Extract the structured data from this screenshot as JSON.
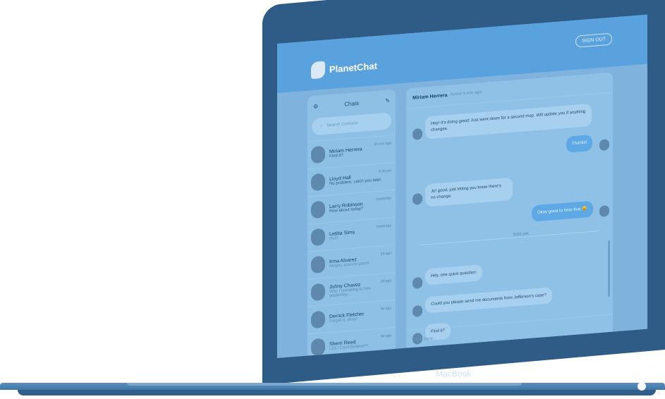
{
  "app": {
    "name": "PlanetChat",
    "signout_label": "SIGN OUT"
  },
  "hardware": {
    "brand": "MacBook"
  },
  "chats": {
    "title": "Chats",
    "search_placeholder": "Search Contacts",
    "items": [
      {
        "name": "Miriam Herrera",
        "message": "Find it?",
        "time": "20 min ago"
      },
      {
        "name": "Lloyd Hall",
        "message": "No problem, catch you later.",
        "time": "6:30 pm"
      },
      {
        "name": "Larry Robinson",
        "message": "How about today?",
        "time": "Yesterday"
      },
      {
        "name": "Letitia Sims",
        "message": "Huh!",
        "time": "Yesterday"
      },
      {
        "name": "Irma Alvarez",
        "message": "Alright, sounds good!",
        "time": "2d ago"
      },
      {
        "name": "Johny Chavez",
        "message": "Was I speaking to him yesterday...",
        "time": "2d ago"
      },
      {
        "name": "Derrick Fletcher",
        "message": "Forget it, okay!",
        "time": "3d ago"
      },
      {
        "name": "Sherri Reed",
        "message": "LOL! Can't Believe!!!",
        "time": "5d ago"
      }
    ]
  },
  "conversation": {
    "contact_name": "Miriam Herrera",
    "contact_status": "Active 5 min ago",
    "messages": [
      {
        "text": "Hey! It's doing great! Just went down for a second map. Will update you if anything changes.",
        "direction": "in"
      },
      {
        "text": "Thanks!",
        "direction": "out"
      },
      {
        "text": "Jo! good, just letting you know there's no change.",
        "direction": "in"
      },
      {
        "text": "Okay great to hear that 😄",
        "direction": "out"
      },
      {
        "text": "Hey, one quick question:",
        "direction": "in"
      },
      {
        "text": "Could you please send me documents from Jefferson's case?",
        "direction": "in"
      },
      {
        "text": "Find it?",
        "direction": "in"
      }
    ],
    "time_separator": "9:02 pm",
    "input_placeholder": "Type Here..."
  }
}
